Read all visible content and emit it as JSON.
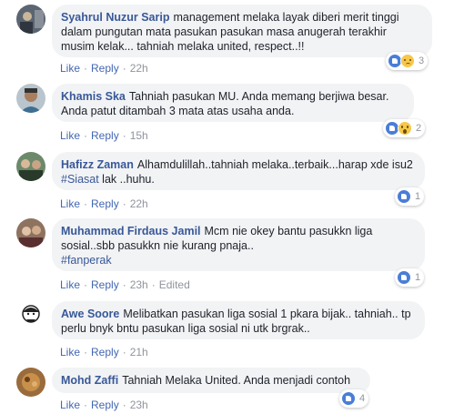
{
  "comments": [
    {
      "author": "Syahrul Nuzur Sarip",
      "text": "management melaka layak diberi merit tinggi dalam pungutan mata pasukan pasukan masa anugerah terakhir musim kelak... tahniah melaka united, respect..!!",
      "hashtag": "",
      "like_label": "Like",
      "reply_label": "Reply",
      "time": "22h",
      "edited": "",
      "reaction_icons": [
        "like-icon",
        "sad-icon"
      ],
      "reaction_count": "3"
    },
    {
      "author": "Khamis Ska",
      "text": "Tahniah pasukan MU. Anda memang berjiwa besar. Anda patut ditambah 3 mata atas usaha anda.",
      "hashtag": "",
      "like_label": "Like",
      "reply_label": "Reply",
      "time": "15h",
      "edited": "",
      "reaction_icons": [
        "like-icon",
        "wow-icon"
      ],
      "reaction_count": "2"
    },
    {
      "author": "Hafizz Zaman",
      "text_before": "Alhamdulillah..tahniah melaka..terbaik...harap xde isu2 ",
      "hashtag": "#Siasat",
      "text_after": " lak ..huhu.",
      "like_label": "Like",
      "reply_label": "Reply",
      "time": "22h",
      "edited": "",
      "reaction_icons": [
        "like-icon"
      ],
      "reaction_count": "1"
    },
    {
      "author": "Muhammad Firdaus Jamil",
      "text": "Mcm nie okey bantu pasukkn liga sosial..sbb pasukkn nie kurang pnaja..",
      "hashtag": "#fanperak",
      "like_label": "Like",
      "reply_label": "Reply",
      "time": "23h",
      "edited": "Edited",
      "reaction_icons": [
        "like-icon"
      ],
      "reaction_count": "1"
    },
    {
      "author": "Awe Soore",
      "text": "Melibatkan pasukan liga sosial 1 pkara bijak.. tahniah.. tp perlu bnyk bntu pasukan liga sosial ni utk brgrak..",
      "hashtag": "",
      "like_label": "Like",
      "reply_label": "Reply",
      "time": "21h",
      "edited": "",
      "reaction_icons": [],
      "reaction_count": ""
    },
    {
      "author": "Mohd Zaffi",
      "text": "Tahniah Melaka United. Anda menjadi contoh",
      "hashtag": "",
      "like_label": "Like",
      "reply_label": "Reply",
      "time": "23h",
      "edited": "",
      "reaction_icons": [
        "like-icon"
      ],
      "reaction_count": "4"
    }
  ],
  "colors": {
    "author": "#385898",
    "link": "#4267b2",
    "meta": "#90949c",
    "bubble": "#f2f3f5"
  }
}
